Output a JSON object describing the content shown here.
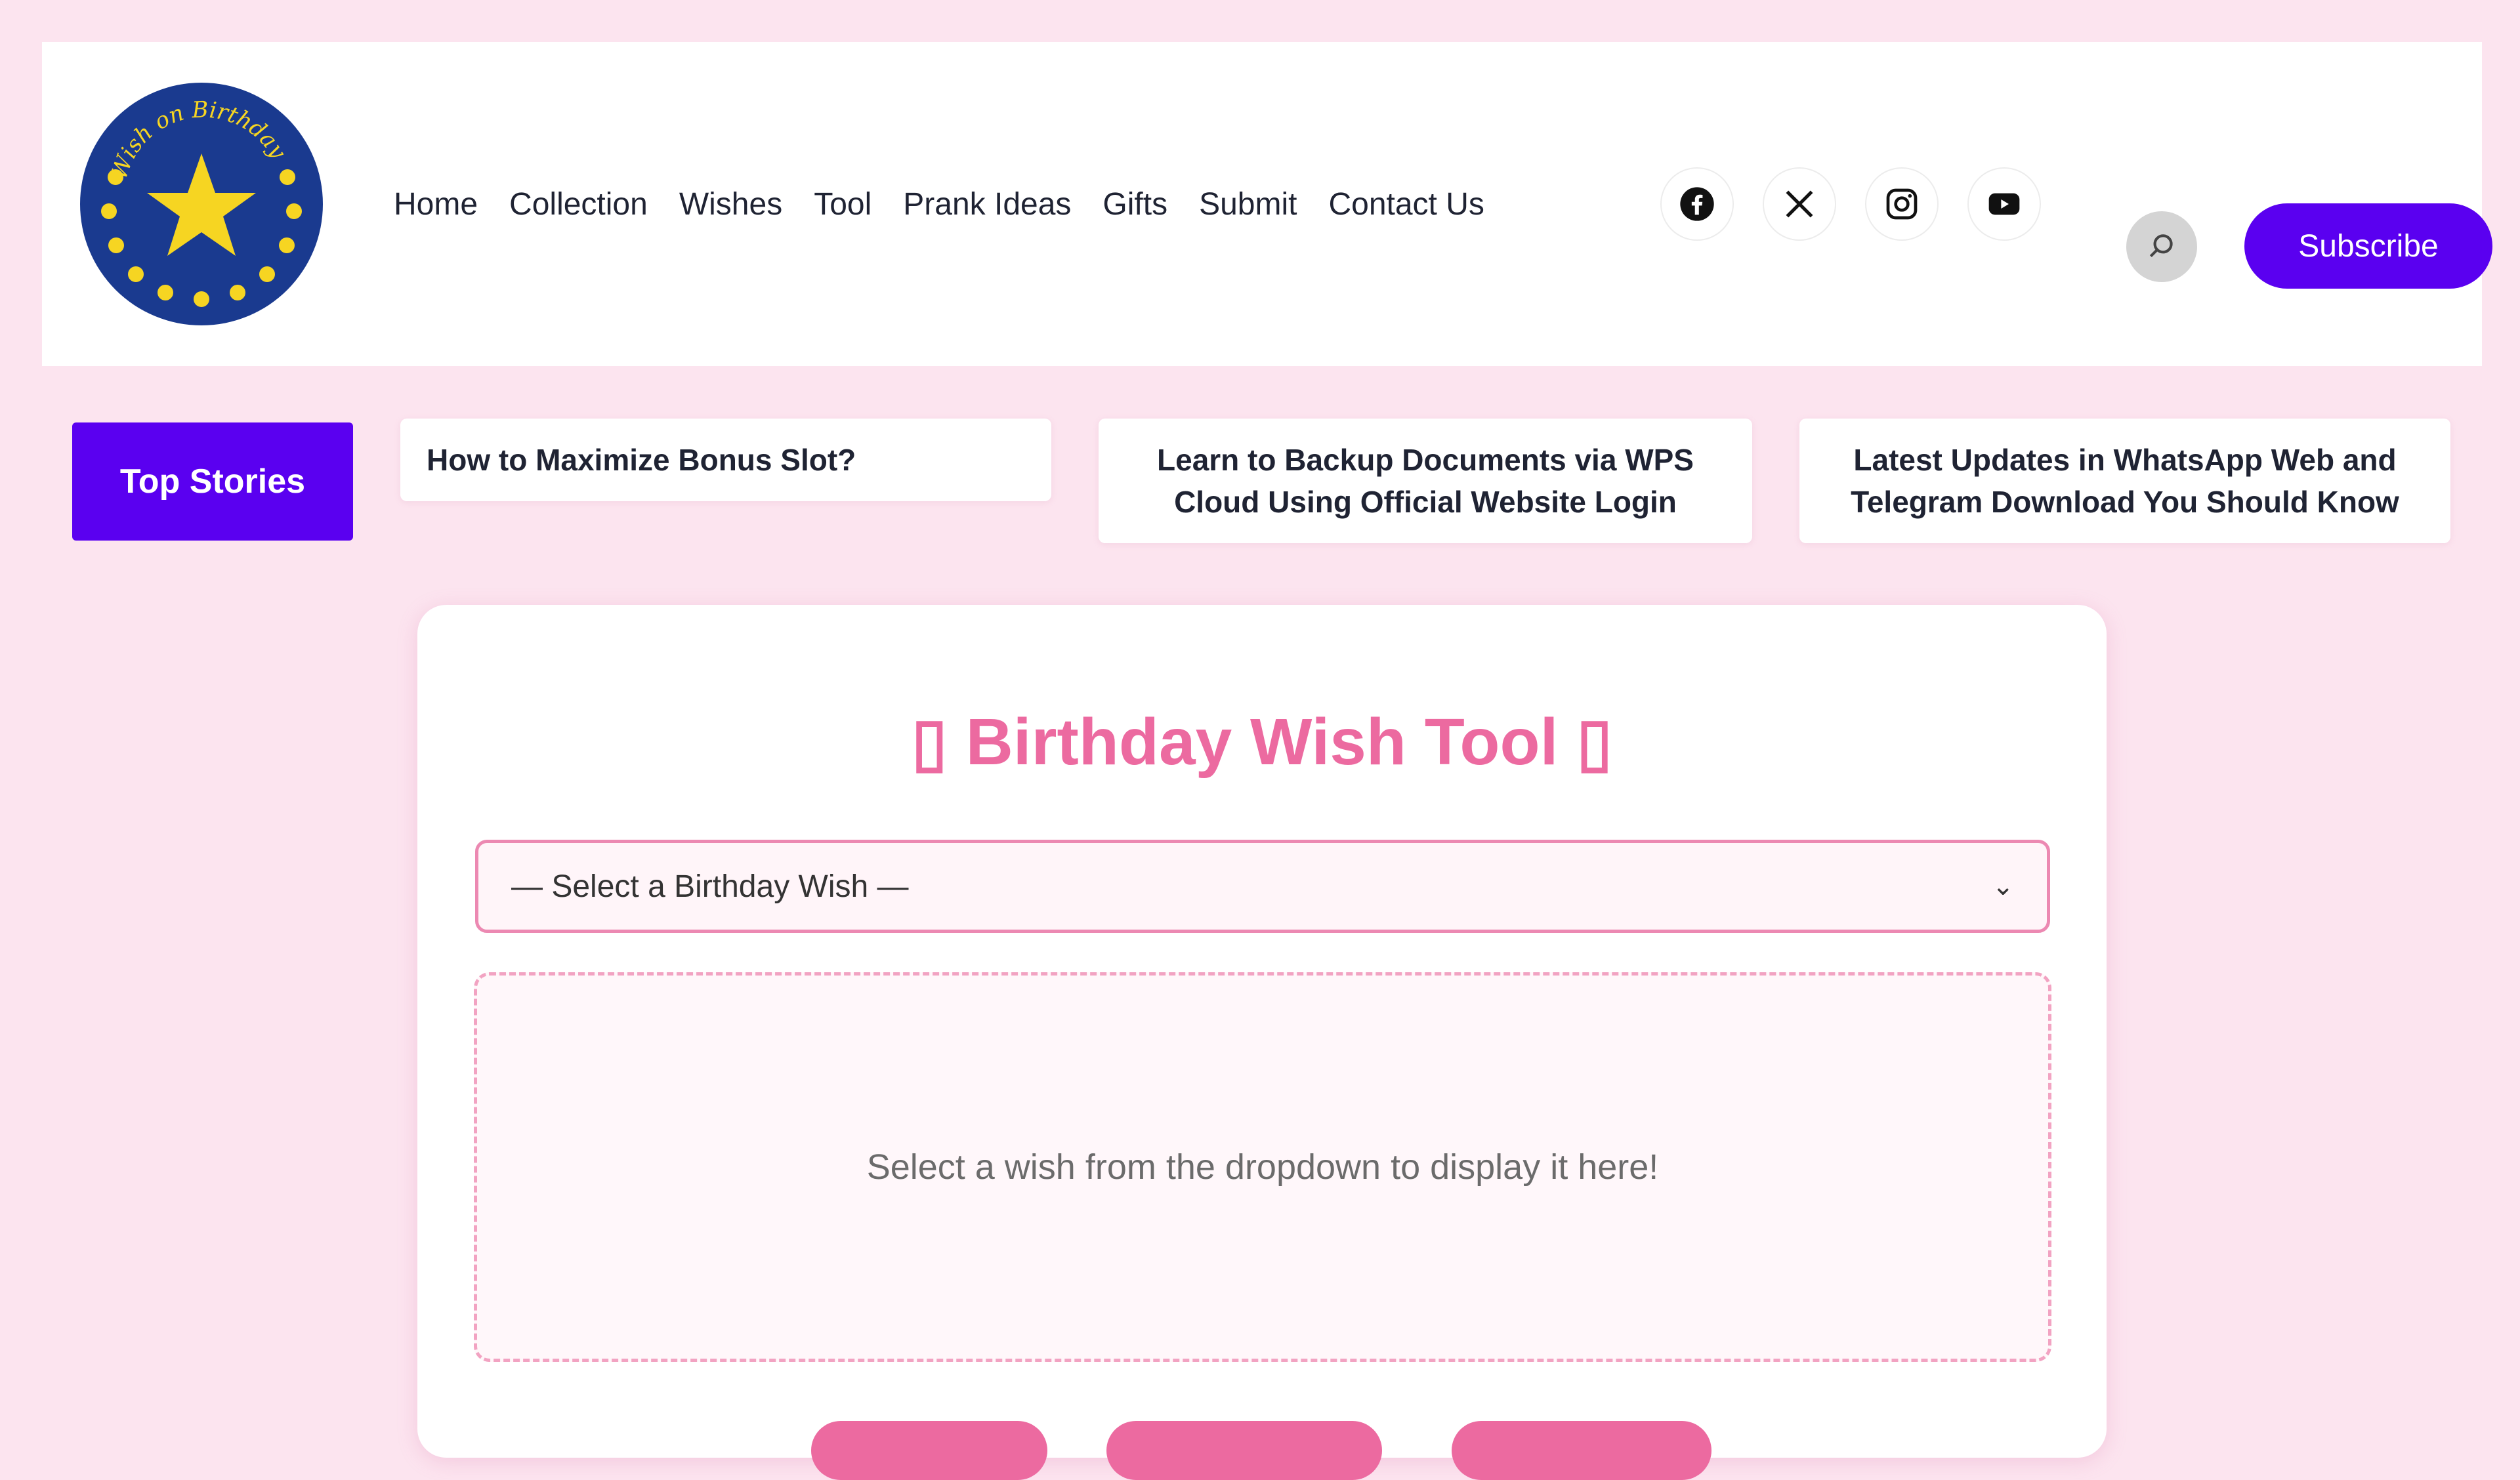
{
  "header": {
    "logo_text": "Wish on Birthday",
    "nav": [
      "Home",
      "Collection",
      "Wishes",
      "Tool",
      "Prank Ideas",
      "Gifts",
      "Submit",
      "Contact Us"
    ],
    "socials": [
      "facebook-icon",
      "x-icon",
      "instagram-icon",
      "youtube-icon"
    ],
    "subscribe_label": "Subscribe"
  },
  "stories": {
    "label": "Top Stories",
    "items": [
      "How to Maximize Bonus Slot?",
      "Learn to Backup Documents via WPS Cloud Using Official Website Login",
      "Latest Updates in WhatsApp Web and Telegram Download You Should Know"
    ]
  },
  "tool": {
    "title": "▯ Birthday Wish Tool ▯",
    "select_value": "— Select a Birthday Wish —",
    "placeholder_text": "Select a wish from the dropdown to display it here!"
  },
  "colors": {
    "page_bg": "#fce4ef",
    "accent_purple": "#5a00f0",
    "accent_pink": "#ec6aa0"
  }
}
